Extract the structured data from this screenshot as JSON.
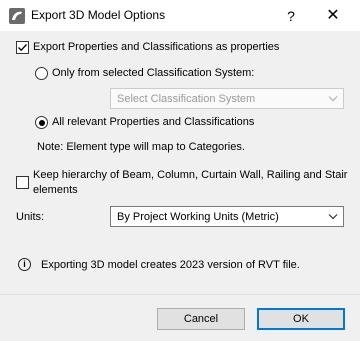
{
  "window": {
    "title": "Export 3D Model Options",
    "help_glyph": "?",
    "close_glyph": "✕"
  },
  "options": {
    "export_properties": {
      "label": "Export Properties and Classifications as properties",
      "checked": true
    },
    "only_selected": {
      "label": "Only from selected Classification System:",
      "selected": false
    },
    "classification_select": {
      "value": "Select Classification System",
      "enabled": false
    },
    "all_relevant": {
      "label": "All relevant Properties and Classifications",
      "selected": true
    },
    "note": "Note: Element type will map to Categories.",
    "keep_hierarchy": {
      "label_line1": "Keep hierarchy of Beam, Column, Curtain Wall, Railing and Stair",
      "label_line2": "elements",
      "checked": false
    }
  },
  "units": {
    "label": "Units:",
    "value": "By Project Working Units (Metric)"
  },
  "info": {
    "icon": "info-icon",
    "icon_glyph": "i",
    "text": "Exporting 3D model creates 2023 version of RVT file."
  },
  "buttons": {
    "cancel": "Cancel",
    "ok": "OK"
  },
  "colors": {
    "accent": "#0078d7",
    "background": "#f0f0f0"
  }
}
